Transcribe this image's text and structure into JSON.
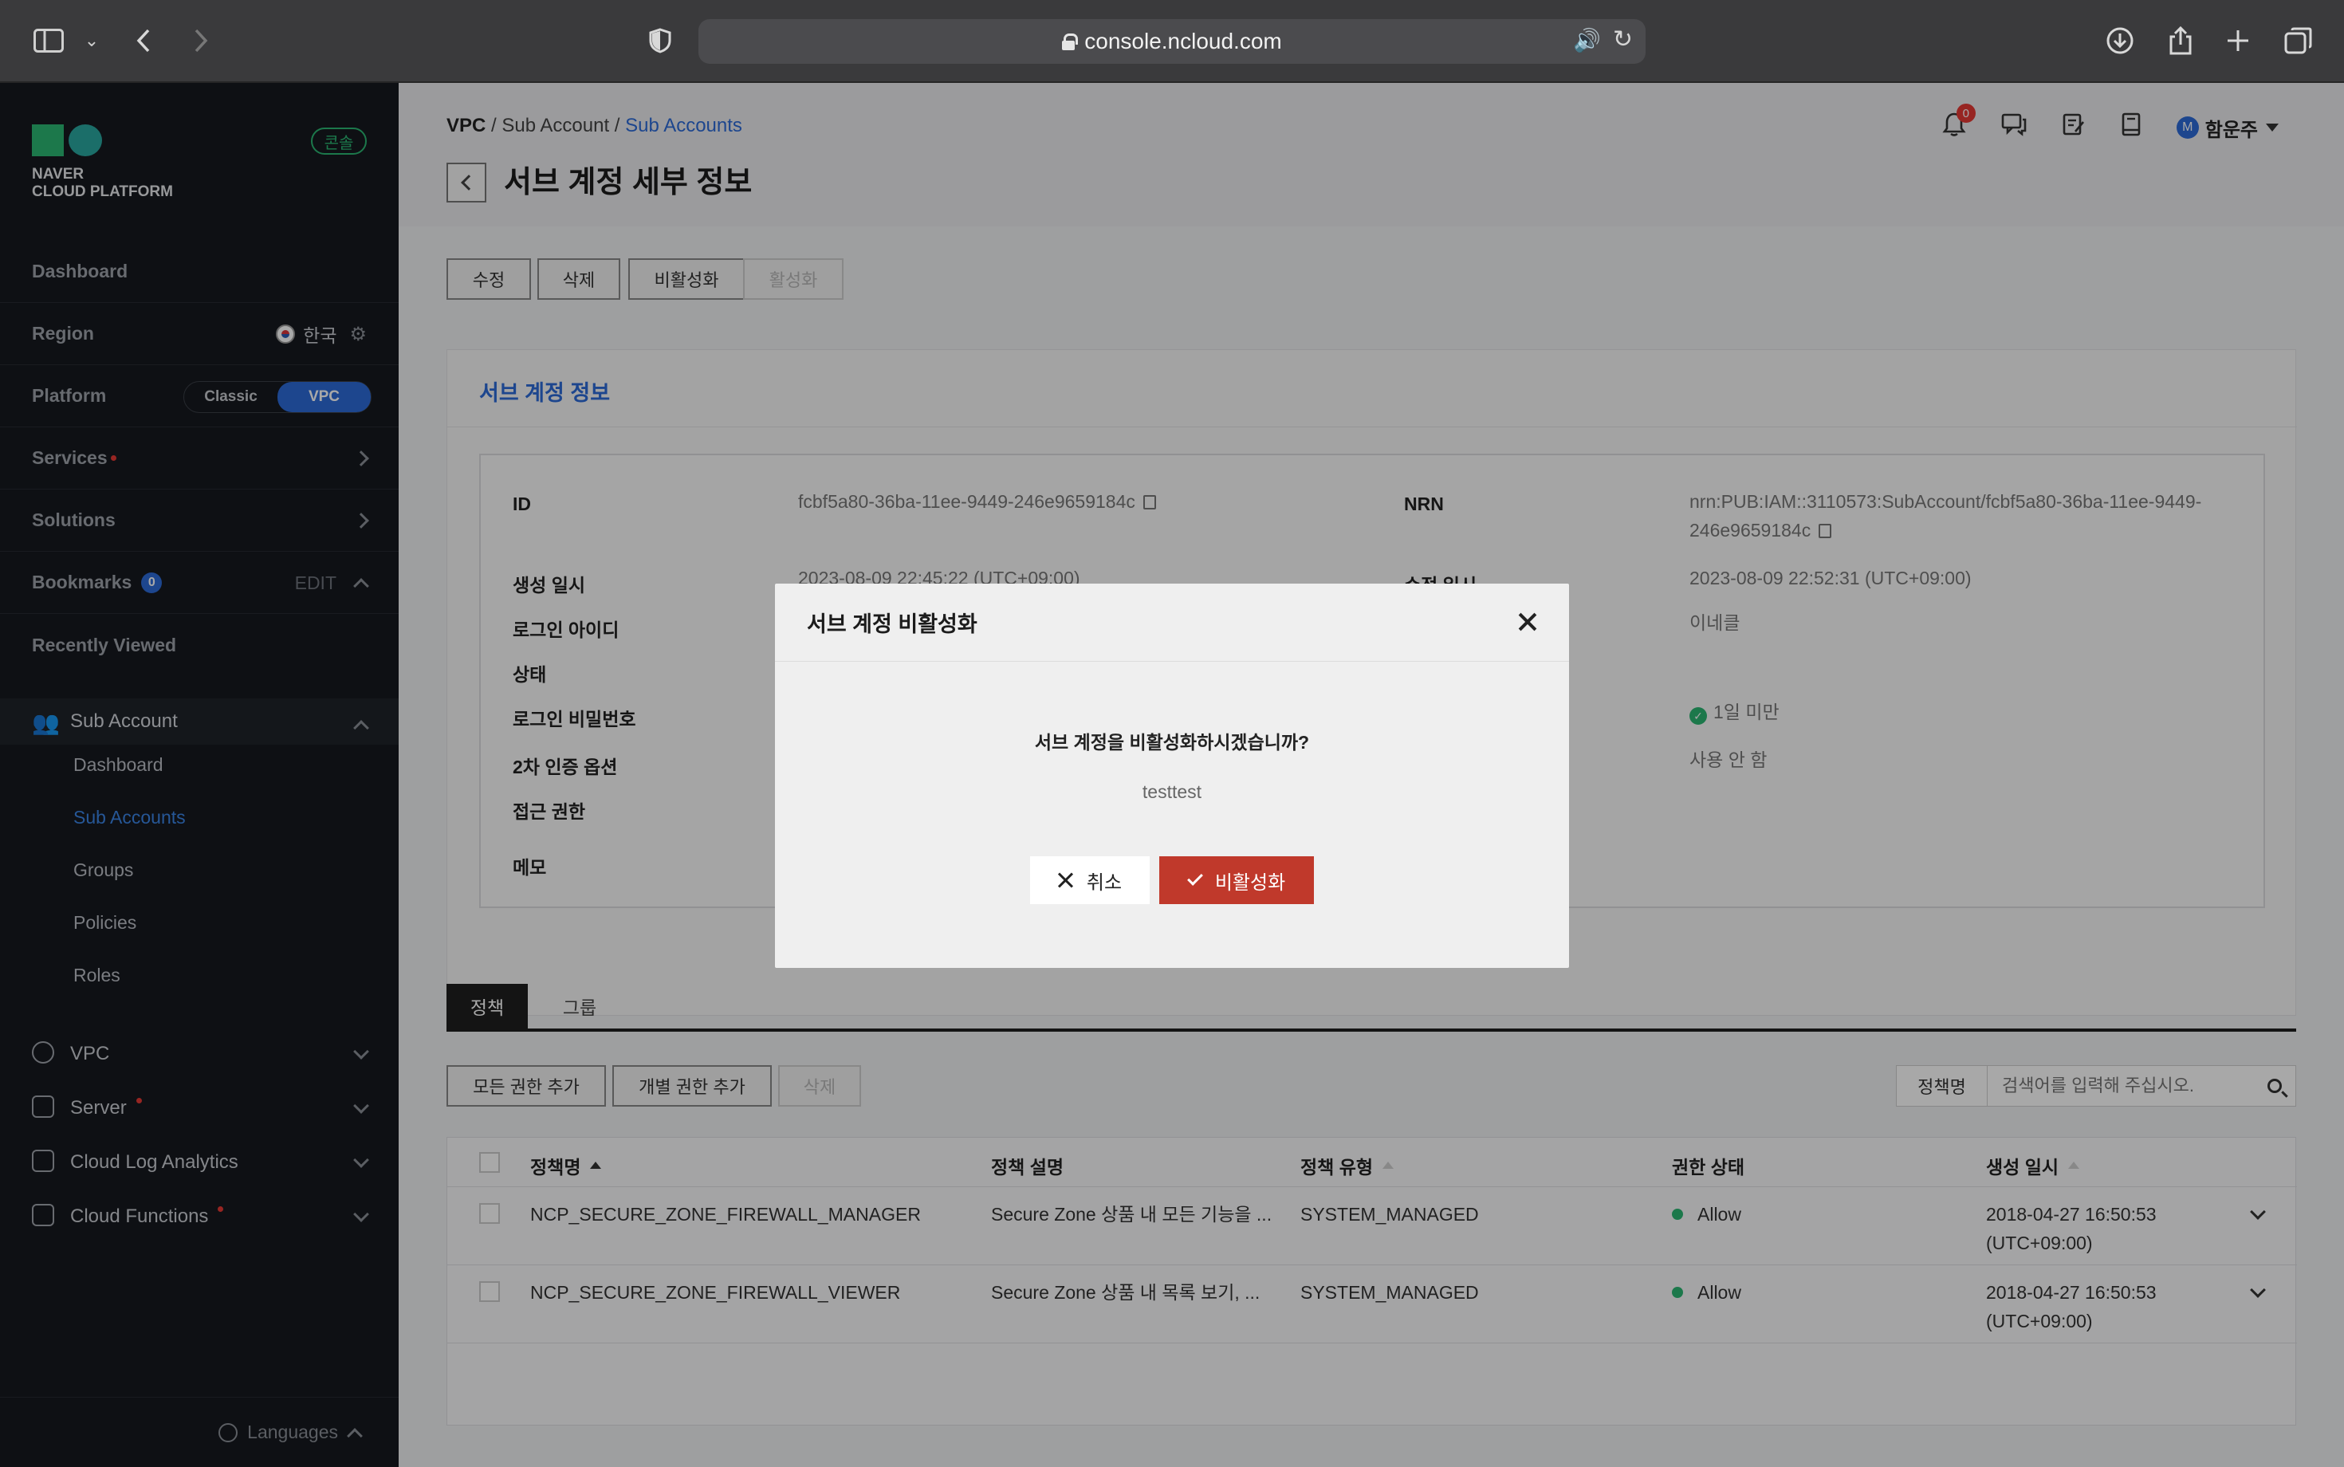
{
  "browser": {
    "url": "console.ncloud.com"
  },
  "sidebar": {
    "logo_line1": "NAVER",
    "logo_line2": "CLOUD PLATFORM",
    "console_badge": "콘솔",
    "dashboard": "Dashboard",
    "region_label": "Region",
    "region_value": "한국",
    "platform_label": "Platform",
    "platform_classic": "Classic",
    "platform_vpc": "VPC",
    "services": "Services",
    "solutions": "Solutions",
    "bookmarks": "Bookmarks",
    "bookmarks_count": "0",
    "bookmarks_edit": "EDIT",
    "recently_viewed": "Recently Viewed",
    "sub_account": "Sub Account",
    "sub_items": [
      "Dashboard",
      "Sub Accounts",
      "Groups",
      "Policies",
      "Roles"
    ],
    "services_list": [
      "VPC",
      "Server",
      "Cloud Log Analytics",
      "Cloud Functions"
    ],
    "languages": "Languages"
  },
  "header": {
    "crumb_1": "VPC",
    "crumb_2": "Sub Account",
    "crumb_3": "Sub Accounts",
    "title": "서브 계정 세부 정보",
    "notif_count": "0",
    "user_initial": "M",
    "user_name": "함운주"
  },
  "actions": {
    "edit": "수정",
    "delete": "삭제",
    "deactivate": "비활성화",
    "activate": "활성화"
  },
  "info": {
    "panel_title": "서브 계정 정보",
    "id_label": "ID",
    "id_value": "fcbf5a80-36ba-11ee-9449-246e9659184c",
    "nrn_label": "NRN",
    "nrn_value_1": "nrn:PUB:IAM::3110573:SubAccount/fcbf5a80-36ba-11ee-9449-",
    "nrn_value_2": "246e9659184c",
    "created_label": "생성 일시",
    "created_value": "2023-08-09 22:45:22 (UTC+09:00)",
    "modified_label": "수정 일시",
    "modified_value": "2023-08-09 22:52:31 (UTC+09:00)",
    "login_id_label": "로그인 아이디",
    "login_id_value": "이네클",
    "status_label": "상태",
    "password_label": "로그인 비밀번호",
    "password_value": "1일 미만",
    "mfa_label": "2차 인증 옵션",
    "mfa_value": "사용 안 함",
    "access_label": "접근 권한",
    "memo_label": "메모"
  },
  "tabs": [
    "정책",
    "그룹"
  ],
  "policy_actions": {
    "add_all": "모든 권한 추가",
    "add_individual": "개별 권한 추가",
    "delete": "삭제",
    "search_select": "정책명",
    "search_placeholder": "검색어를 입력해 주십시오."
  },
  "table": {
    "columns": [
      "정책명",
      "정책 설명",
      "정책 유형",
      "권한 상태",
      "생성 일시"
    ],
    "rows": [
      {
        "name": "NCP_SECURE_ZONE_FIREWALL_MANAGER",
        "desc": "Secure Zone 상품 내 모든 기능을 ...",
        "type": "SYSTEM_MANAGED",
        "status": "Allow",
        "date_1": "2018-04-27 16:50:53",
        "date_2": "(UTC+09:00)"
      },
      {
        "name": "NCP_SECURE_ZONE_FIREWALL_VIEWER",
        "desc": "Secure Zone 상품 내 목록 보기, ...",
        "type": "SYSTEM_MANAGED",
        "status": "Allow",
        "date_1": "2018-04-27 16:50:53",
        "date_2": "(UTC+09:00)"
      }
    ]
  },
  "modal": {
    "title": "서브 계정 비활성화",
    "question": "서브 계정을 비활성화하시겠습니까?",
    "account_name": "testtest",
    "cancel": "취소",
    "confirm": "비활성화"
  },
  "colors": {
    "accent": "#2d6bd8",
    "danger": "#c0392b",
    "success": "#2bb673",
    "sidebar_bg": "#16191f"
  }
}
